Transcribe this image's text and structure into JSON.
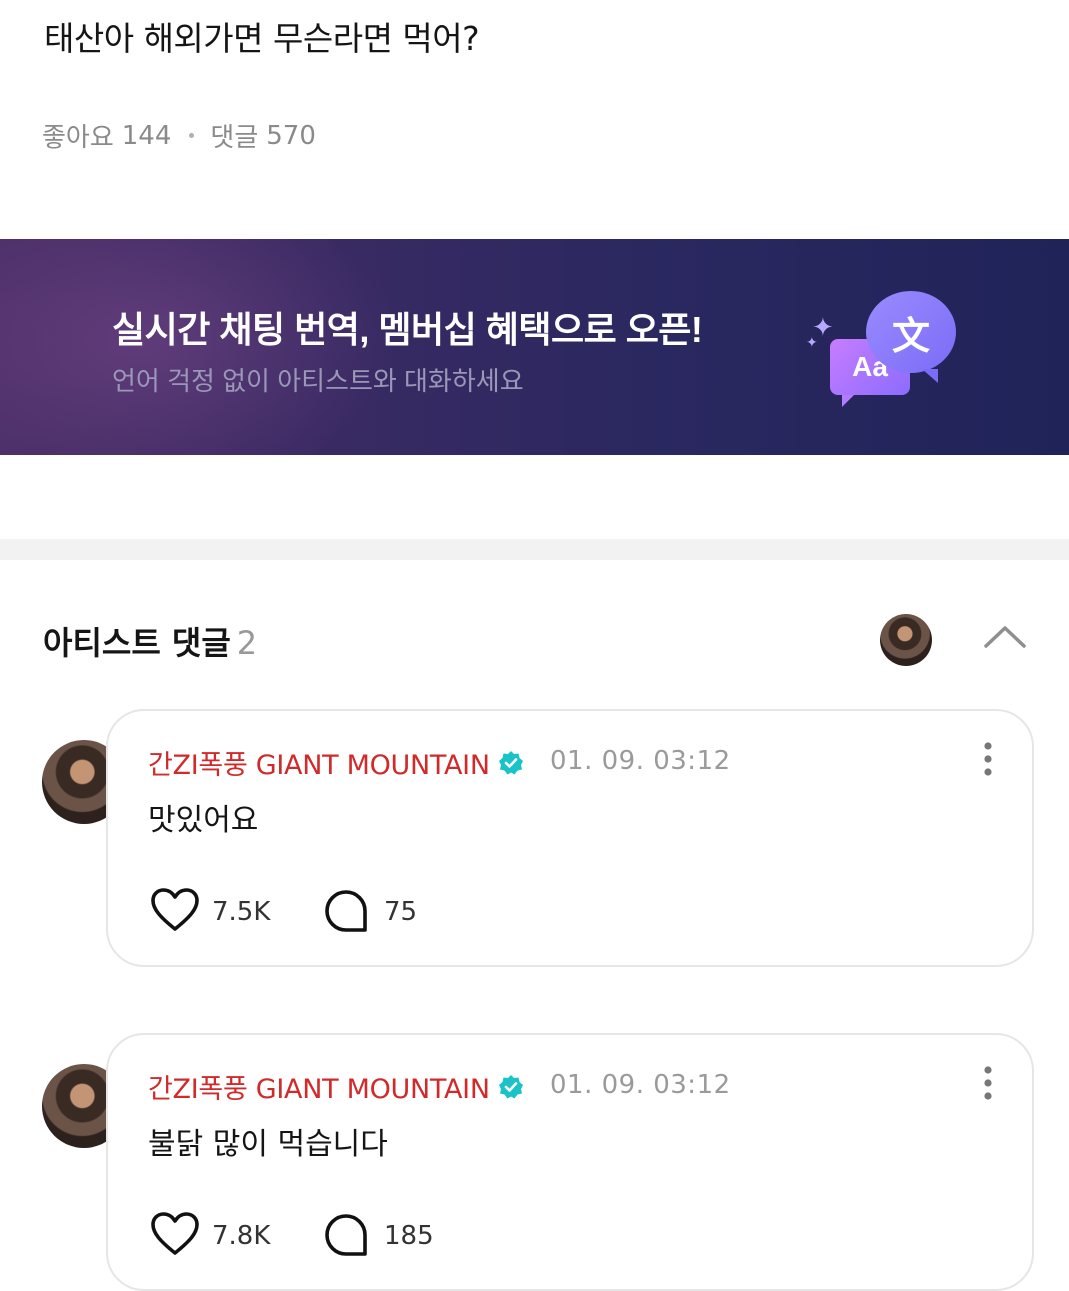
{
  "post": {
    "title": "태산아 해외가면 무슨라면 먹어?",
    "likes_label": "좋아요",
    "likes_count": "144",
    "comments_label": "댓글",
    "comments_count": "570"
  },
  "banner": {
    "title": "실시간 채팅 번역, 멤버십 혜택으로 오픈!",
    "subtitle": "언어 걱정 없이 아티스트와 대화하세요",
    "icon_aa": "Aa",
    "icon_wen": "文"
  },
  "artist_comments": {
    "title": "아티스트 댓글",
    "count": "2"
  },
  "comments": [
    {
      "author": "간ZI폭풍 GIANT MOUNTAIN",
      "date": "01. 09. 03:12",
      "text": "맛있어요",
      "likes": "7.5K",
      "replies": "75"
    },
    {
      "author": "간ZI폭풍 GIANT MOUNTAIN",
      "date": "01. 09. 03:12",
      "text": "불닭 많이 먹습니다",
      "likes": "7.8K",
      "replies": "185"
    }
  ],
  "colors": {
    "author": "#d02a2a",
    "verified": "#19c3c8",
    "banner_start": "#4a2e67",
    "banner_end": "#1f2358"
  }
}
